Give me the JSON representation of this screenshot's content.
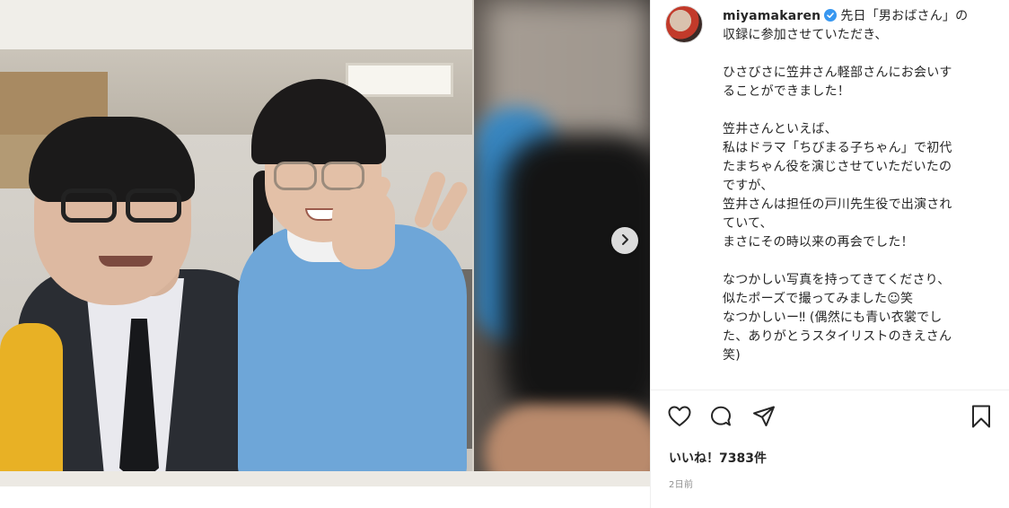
{
  "post": {
    "username": "miyamakaren",
    "verified_icon": "verified-badge-icon",
    "caption": "先日「男おばさん」の\n収録に参加させていただき、\n\nひさびさに笠井さん軽部さんにお会いす\nることができました！\n\n笠井さんといえば、\n私はドラマ「ちびまる子ちゃん」で初代\nたまちゃん役を演じさせていただいたの\nですが、\n笠井さんは担任の戸川先生役で出演され\nていて、\nまさにその時以来の再会でした！\n\nなつかしい写真を持ってきてくださり、\n似たポーズで撮ってみました☺︎笑\nなつかしいー‼︎ (偶然にも青い衣裳でし\nた、ありがとうスタイリストのきえさん\n笑)",
    "likes": "いいね！7383件",
    "time": "2日前"
  },
  "media": {
    "next_icon": "chevron-right-icon"
  },
  "actions": {
    "like_icon": "heart-icon",
    "comment_icon": "comment-icon",
    "share_icon": "paper-plane-icon",
    "save_icon": "bookmark-icon"
  },
  "colors": {
    "text": "#262626",
    "muted": "#8e8e8e",
    "verified": "#3897f0",
    "border": "#efefef"
  }
}
